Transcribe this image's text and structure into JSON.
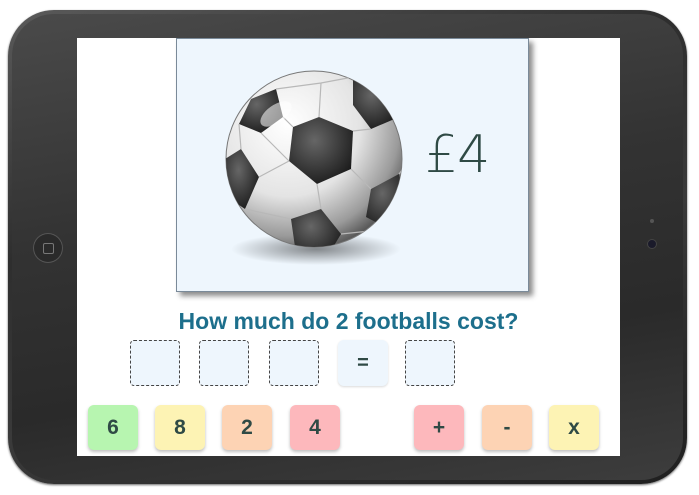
{
  "card": {
    "price": "£4",
    "image": "football-icon"
  },
  "question": "How much do 2 footballs cost?",
  "answer": {
    "slots": [
      "",
      "",
      "",
      ""
    ],
    "equals": "="
  },
  "number_tiles": [
    {
      "label": "6",
      "color": "#b7f5b0"
    },
    {
      "label": "8",
      "color": "#fdf3b4"
    },
    {
      "label": "2",
      "color": "#fdd3b4"
    },
    {
      "label": "4",
      "color": "#fdb8bc"
    }
  ],
  "operator_tiles": [
    {
      "label": "+",
      "color": "#fdb8bc"
    },
    {
      "label": "-",
      "color": "#fdd3b4"
    },
    {
      "label": "x",
      "color": "#fdf3b4"
    }
  ]
}
